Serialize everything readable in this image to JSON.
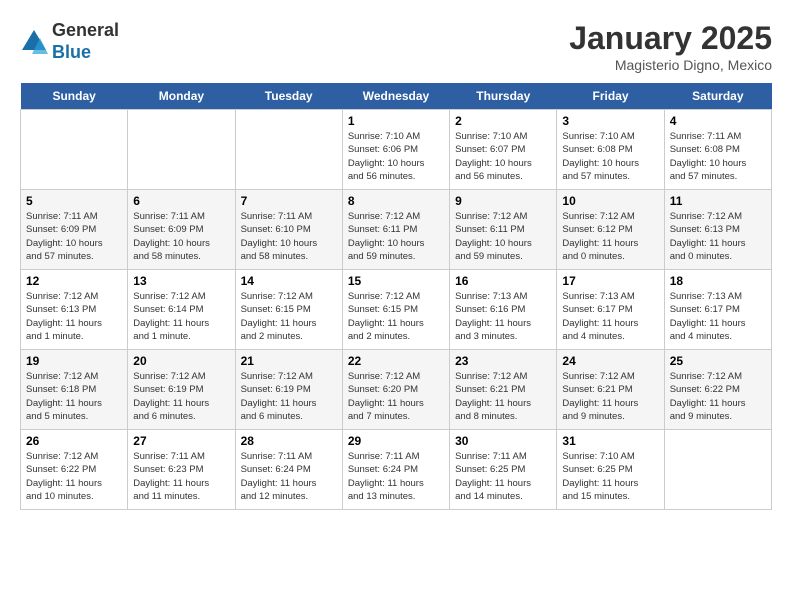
{
  "header": {
    "logo_general": "General",
    "logo_blue": "Blue",
    "month_title": "January 2025",
    "subtitle": "Magisterio Digno, Mexico"
  },
  "days": [
    "Sunday",
    "Monday",
    "Tuesday",
    "Wednesday",
    "Thursday",
    "Friday",
    "Saturday"
  ],
  "weeks": [
    [
      {
        "date": "",
        "info": ""
      },
      {
        "date": "",
        "info": ""
      },
      {
        "date": "",
        "info": ""
      },
      {
        "date": "1",
        "info": "Sunrise: 7:10 AM\nSunset: 6:06 PM\nDaylight: 10 hours\nand 56 minutes."
      },
      {
        "date": "2",
        "info": "Sunrise: 7:10 AM\nSunset: 6:07 PM\nDaylight: 10 hours\nand 56 minutes."
      },
      {
        "date": "3",
        "info": "Sunrise: 7:10 AM\nSunset: 6:08 PM\nDaylight: 10 hours\nand 57 minutes."
      },
      {
        "date": "4",
        "info": "Sunrise: 7:11 AM\nSunset: 6:08 PM\nDaylight: 10 hours\nand 57 minutes."
      }
    ],
    [
      {
        "date": "5",
        "info": "Sunrise: 7:11 AM\nSunset: 6:09 PM\nDaylight: 10 hours\nand 57 minutes."
      },
      {
        "date": "6",
        "info": "Sunrise: 7:11 AM\nSunset: 6:09 PM\nDaylight: 10 hours\nand 58 minutes."
      },
      {
        "date": "7",
        "info": "Sunrise: 7:11 AM\nSunset: 6:10 PM\nDaylight: 10 hours\nand 58 minutes."
      },
      {
        "date": "8",
        "info": "Sunrise: 7:12 AM\nSunset: 6:11 PM\nDaylight: 10 hours\nand 59 minutes."
      },
      {
        "date": "9",
        "info": "Sunrise: 7:12 AM\nSunset: 6:11 PM\nDaylight: 10 hours\nand 59 minutes."
      },
      {
        "date": "10",
        "info": "Sunrise: 7:12 AM\nSunset: 6:12 PM\nDaylight: 11 hours\nand 0 minutes."
      },
      {
        "date": "11",
        "info": "Sunrise: 7:12 AM\nSunset: 6:13 PM\nDaylight: 11 hours\nand 0 minutes."
      }
    ],
    [
      {
        "date": "12",
        "info": "Sunrise: 7:12 AM\nSunset: 6:13 PM\nDaylight: 11 hours\nand 1 minute."
      },
      {
        "date": "13",
        "info": "Sunrise: 7:12 AM\nSunset: 6:14 PM\nDaylight: 11 hours\nand 1 minute."
      },
      {
        "date": "14",
        "info": "Sunrise: 7:12 AM\nSunset: 6:15 PM\nDaylight: 11 hours\nand 2 minutes."
      },
      {
        "date": "15",
        "info": "Sunrise: 7:12 AM\nSunset: 6:15 PM\nDaylight: 11 hours\nand 2 minutes."
      },
      {
        "date": "16",
        "info": "Sunrise: 7:13 AM\nSunset: 6:16 PM\nDaylight: 11 hours\nand 3 minutes."
      },
      {
        "date": "17",
        "info": "Sunrise: 7:13 AM\nSunset: 6:17 PM\nDaylight: 11 hours\nand 4 minutes."
      },
      {
        "date": "18",
        "info": "Sunrise: 7:13 AM\nSunset: 6:17 PM\nDaylight: 11 hours\nand 4 minutes."
      }
    ],
    [
      {
        "date": "19",
        "info": "Sunrise: 7:12 AM\nSunset: 6:18 PM\nDaylight: 11 hours\nand 5 minutes."
      },
      {
        "date": "20",
        "info": "Sunrise: 7:12 AM\nSunset: 6:19 PM\nDaylight: 11 hours\nand 6 minutes."
      },
      {
        "date": "21",
        "info": "Sunrise: 7:12 AM\nSunset: 6:19 PM\nDaylight: 11 hours\nand 6 minutes."
      },
      {
        "date": "22",
        "info": "Sunrise: 7:12 AM\nSunset: 6:20 PM\nDaylight: 11 hours\nand 7 minutes."
      },
      {
        "date": "23",
        "info": "Sunrise: 7:12 AM\nSunset: 6:21 PM\nDaylight: 11 hours\nand 8 minutes."
      },
      {
        "date": "24",
        "info": "Sunrise: 7:12 AM\nSunset: 6:21 PM\nDaylight: 11 hours\nand 9 minutes."
      },
      {
        "date": "25",
        "info": "Sunrise: 7:12 AM\nSunset: 6:22 PM\nDaylight: 11 hours\nand 9 minutes."
      }
    ],
    [
      {
        "date": "26",
        "info": "Sunrise: 7:12 AM\nSunset: 6:22 PM\nDaylight: 11 hours\nand 10 minutes."
      },
      {
        "date": "27",
        "info": "Sunrise: 7:11 AM\nSunset: 6:23 PM\nDaylight: 11 hours\nand 11 minutes."
      },
      {
        "date": "28",
        "info": "Sunrise: 7:11 AM\nSunset: 6:24 PM\nDaylight: 11 hours\nand 12 minutes."
      },
      {
        "date": "29",
        "info": "Sunrise: 7:11 AM\nSunset: 6:24 PM\nDaylight: 11 hours\nand 13 minutes."
      },
      {
        "date": "30",
        "info": "Sunrise: 7:11 AM\nSunset: 6:25 PM\nDaylight: 11 hours\nand 14 minutes."
      },
      {
        "date": "31",
        "info": "Sunrise: 7:10 AM\nSunset: 6:25 PM\nDaylight: 11 hours\nand 15 minutes."
      },
      {
        "date": "",
        "info": ""
      }
    ]
  ]
}
